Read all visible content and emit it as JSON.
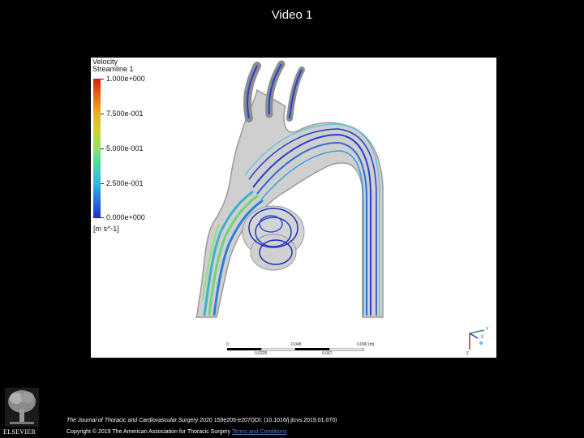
{
  "slide": {
    "title": "Video 1"
  },
  "figure": {
    "legend_title_line1": "Velocity",
    "legend_title_line2": "Streamline 1",
    "ticks": [
      "1.000e+000",
      "7.500e-001",
      "5.000e-001",
      "2.500e-001",
      "0.000e+000"
    ],
    "units": "[m s^-1]",
    "scale_top": [
      "0",
      "0.045",
      "0.090 (m)"
    ],
    "scale_bottom": [
      "0.0225",
      "0.067"
    ],
    "axes": {
      "x": "X",
      "y": "Y",
      "z": "Z"
    }
  },
  "footer": {
    "journal": "The Journal of Thoracic and Cardiovascular Surgery",
    "citation_rest": " 2020 159e205-e207DOI: (10.1016/j.jtcvs.2019.01.070)",
    "copyright": "Copyright © 2019 The American Association for Thoracic Surgery",
    "terms_link": "Terms and Conditions",
    "publisher": "ELSEVIER"
  },
  "colors": {
    "background": "#000000",
    "figure_bg": "#ffffff",
    "stream_blue": "#2233cc",
    "link": "#5a7fd6"
  }
}
